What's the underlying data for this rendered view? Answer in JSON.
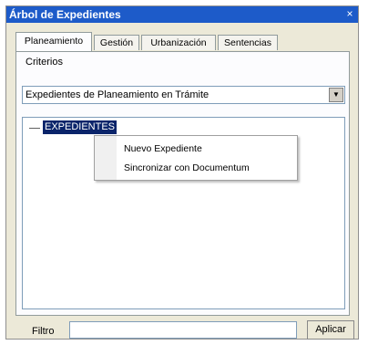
{
  "window": {
    "title": "Árbol de Expedientes",
    "close_glyph": "×"
  },
  "tabs": [
    {
      "label": "Planeamiento",
      "active": true
    },
    {
      "label": "Gestión",
      "active": false
    },
    {
      "label": "Urbanización",
      "active": false
    },
    {
      "label": "Sentencias",
      "active": false
    }
  ],
  "criteria": {
    "label": "Criterios",
    "selected": "Expedientes de Planeamiento en Trámite",
    "arrow": "▼"
  },
  "tree": {
    "root_label": "EXPEDIENTES"
  },
  "context_menu": {
    "items": [
      "Nuevo Expediente",
      "Sincronizar con Documentum"
    ]
  },
  "filter": {
    "label": "Filtro",
    "value": "",
    "apply_label": "Aplicar"
  },
  "colors": {
    "titlebar": "#1d5bc9",
    "selection": "#0a246a",
    "window_bg": "#ece9d8"
  }
}
